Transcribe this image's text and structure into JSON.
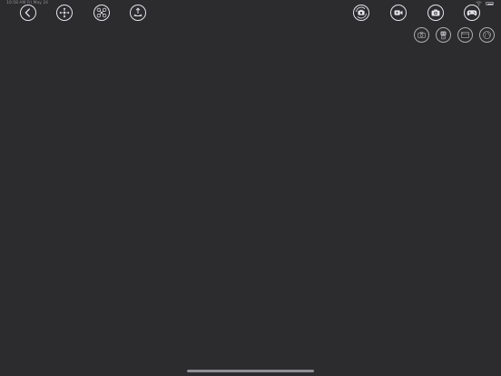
{
  "status_bar": {
    "time": "10:58 AM Fri May 24"
  },
  "toolbar_left": [
    {
      "name": "back-button",
      "icon": "chevron-left-icon"
    },
    {
      "name": "move-button",
      "icon": "move-arrows-icon"
    },
    {
      "name": "flip-button",
      "icon": "drone-flip-icon"
    },
    {
      "name": "takeoff-button",
      "icon": "takeoff-icon"
    }
  ],
  "toolbar_right": [
    {
      "name": "switch-camera-button",
      "icon": "camera-rotate-icon"
    },
    {
      "name": "record-video-button",
      "icon": "video-icon"
    },
    {
      "name": "take-photo-button",
      "icon": "camera-icon"
    },
    {
      "name": "gamepad-button",
      "icon": "gamepad-icon"
    }
  ],
  "toolbar_secondary": [
    {
      "name": "photo-mode-button",
      "icon": "camera-outline-icon"
    },
    {
      "name": "gallery-button",
      "icon": "robot-icon"
    },
    {
      "name": "window-button",
      "icon": "window-icon"
    },
    {
      "name": "globe-button",
      "icon": "globe-icon"
    }
  ],
  "colors": {
    "background": "#2c2c2e",
    "icon_primary": "#e5e5ea",
    "icon_secondary": "#aeaeb2"
  }
}
